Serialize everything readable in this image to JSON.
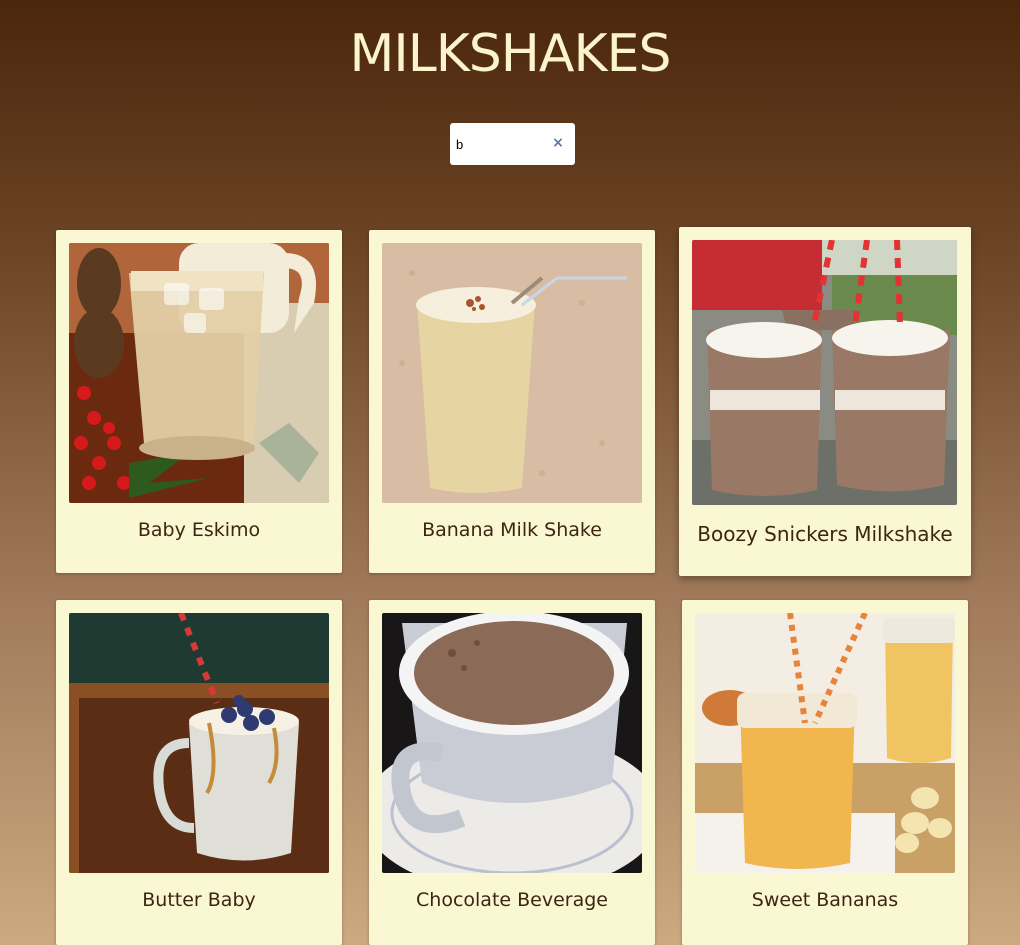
{
  "page": {
    "title": "MILKSHAKES"
  },
  "search": {
    "value": "b",
    "clear_icon": "×"
  },
  "drinks": [
    {
      "name": "Baby Eskimo"
    },
    {
      "name": "Banana Milk Shake"
    },
    {
      "name": "Boozy Snickers Milkshake"
    },
    {
      "name": "Butter Baby"
    },
    {
      "name": "Chocolate Beverage"
    },
    {
      "name": "Sweet Bananas"
    }
  ]
}
